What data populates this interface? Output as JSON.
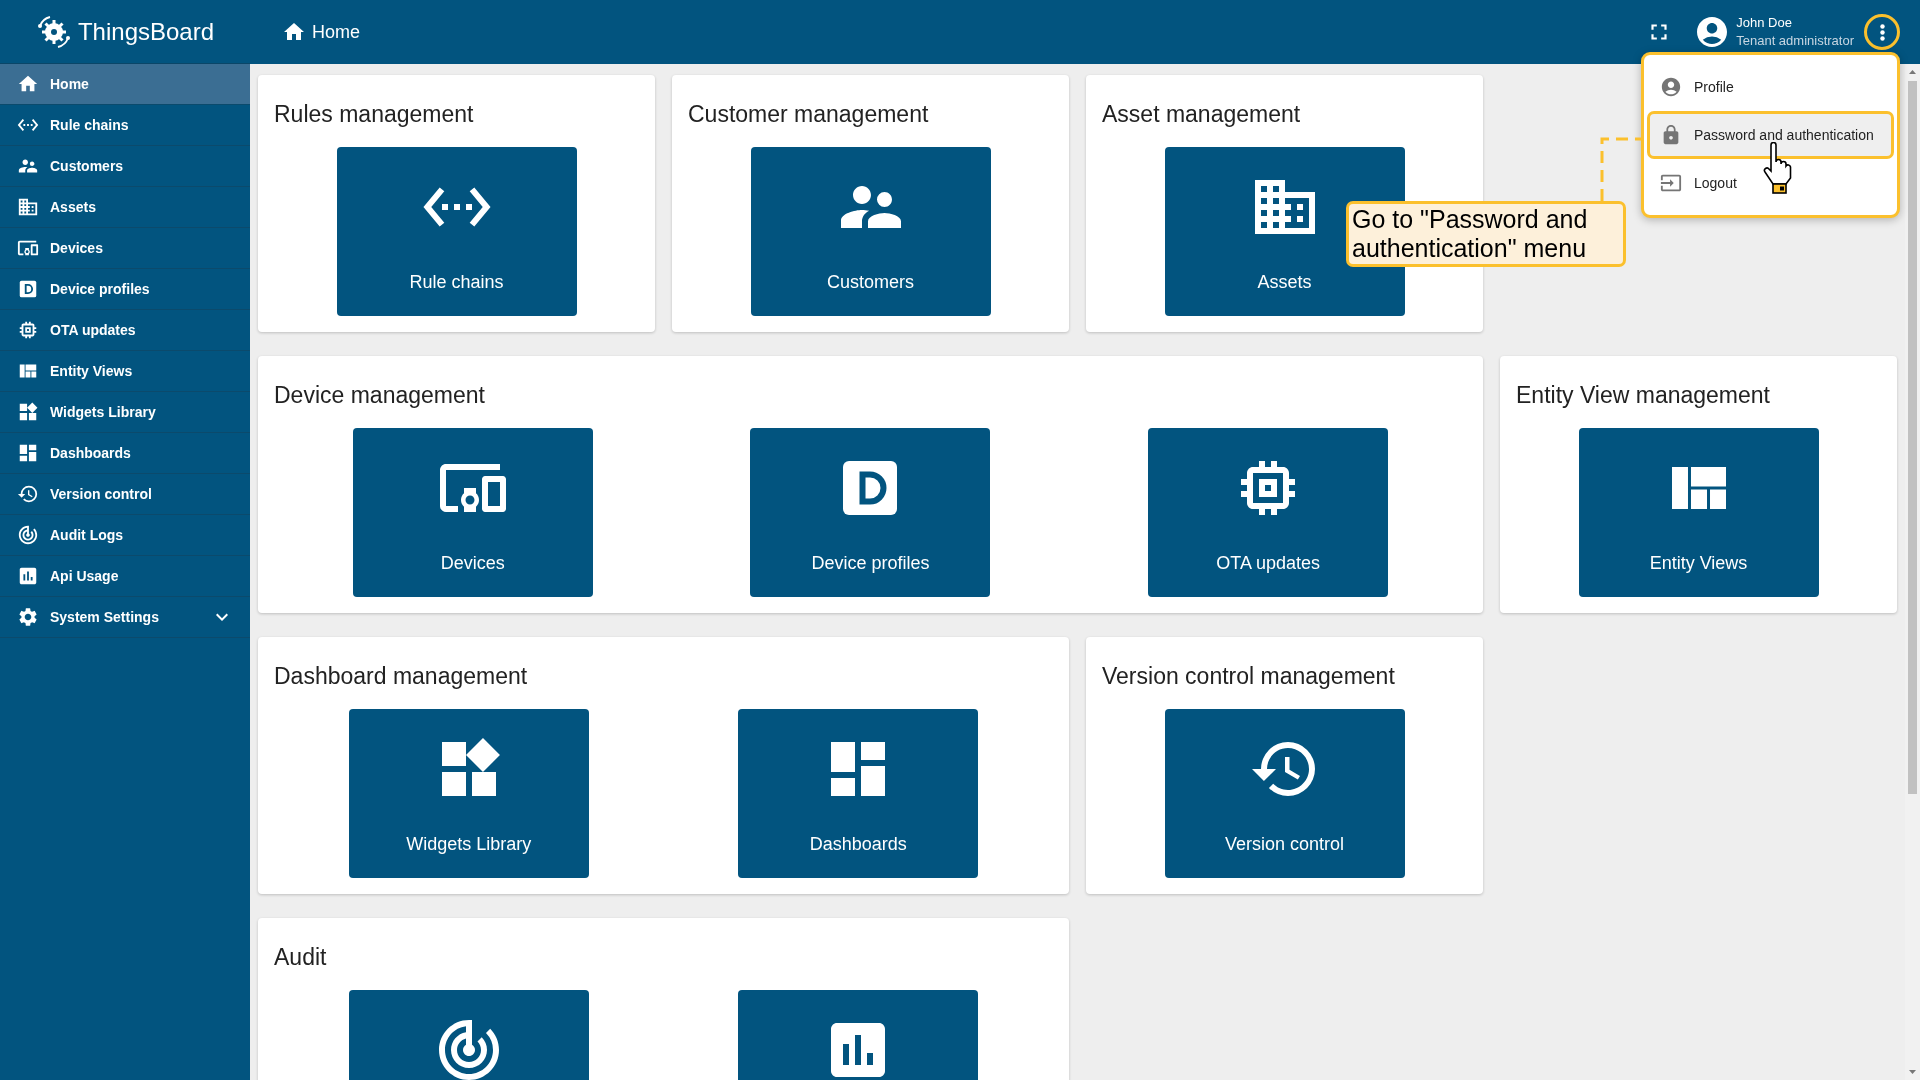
{
  "app": {
    "name": "ThingsBoard"
  },
  "sidebar": {
    "items": [
      {
        "label": "Home",
        "selected": true,
        "kind": "link"
      },
      {
        "label": "Rule chains",
        "selected": false,
        "kind": "link"
      },
      {
        "label": "Customers",
        "selected": false,
        "kind": "link"
      },
      {
        "label": "Assets",
        "selected": false,
        "kind": "link"
      },
      {
        "label": "Devices",
        "selected": false,
        "kind": "link"
      },
      {
        "label": "Device profiles",
        "selected": false,
        "kind": "link"
      },
      {
        "label": "OTA updates",
        "selected": false,
        "kind": "link"
      },
      {
        "label": "Entity Views",
        "selected": false,
        "kind": "link"
      },
      {
        "label": "Widgets Library",
        "selected": false,
        "kind": "link"
      },
      {
        "label": "Dashboards",
        "selected": false,
        "kind": "link"
      },
      {
        "label": "Version control",
        "selected": false,
        "kind": "link"
      },
      {
        "label": "Audit Logs",
        "selected": false,
        "kind": "link"
      },
      {
        "label": "Api Usage",
        "selected": false,
        "kind": "link"
      },
      {
        "label": "System Settings",
        "selected": false,
        "kind": "group",
        "expanded": false
      }
    ]
  },
  "header": {
    "breadcrumb": "Home",
    "user": {
      "name": "John Doe",
      "role": "Tenant administrator"
    }
  },
  "user_menu": {
    "open": true,
    "items": [
      {
        "label": "Profile",
        "selected": false
      },
      {
        "label": "Password and authentication",
        "selected": true
      },
      {
        "label": "Logout",
        "selected": false
      }
    ]
  },
  "annotation": {
    "text": "Go to \"Password and authentication\" menu"
  },
  "sections": [
    {
      "title": "Rules management",
      "tiles": [
        {
          "kind": "tile",
          "label": "Rule chains"
        }
      ]
    },
    {
      "title": "Customer management",
      "tiles": [
        {
          "kind": "tile",
          "label": "Customers"
        }
      ]
    },
    {
      "title": "Asset management",
      "tiles": [
        {
          "kind": "tile",
          "label": "Assets"
        }
      ]
    },
    {
      "title": "Device management",
      "tiles": [
        {
          "kind": "tile",
          "label": "Devices"
        },
        {
          "kind": "tile",
          "label": "Device profiles"
        },
        {
          "kind": "tile",
          "label": "OTA updates"
        }
      ]
    },
    {
      "title": "Entity View management",
      "tiles": [
        {
          "kind": "tile",
          "label": "Entity Views"
        }
      ]
    },
    {
      "title": "Dashboard management",
      "tiles": [
        {
          "kind": "tile",
          "label": "Widgets Library"
        },
        {
          "kind": "tile",
          "label": "Dashboards"
        }
      ]
    },
    {
      "title": "Version control management",
      "tiles": [
        {
          "kind": "tile",
          "label": "Version control"
        }
      ]
    },
    {
      "title": "Audit",
      "tiles": [
        {
          "kind": "tile"
        },
        {
          "kind": "tile"
        }
      ]
    }
  ]
}
